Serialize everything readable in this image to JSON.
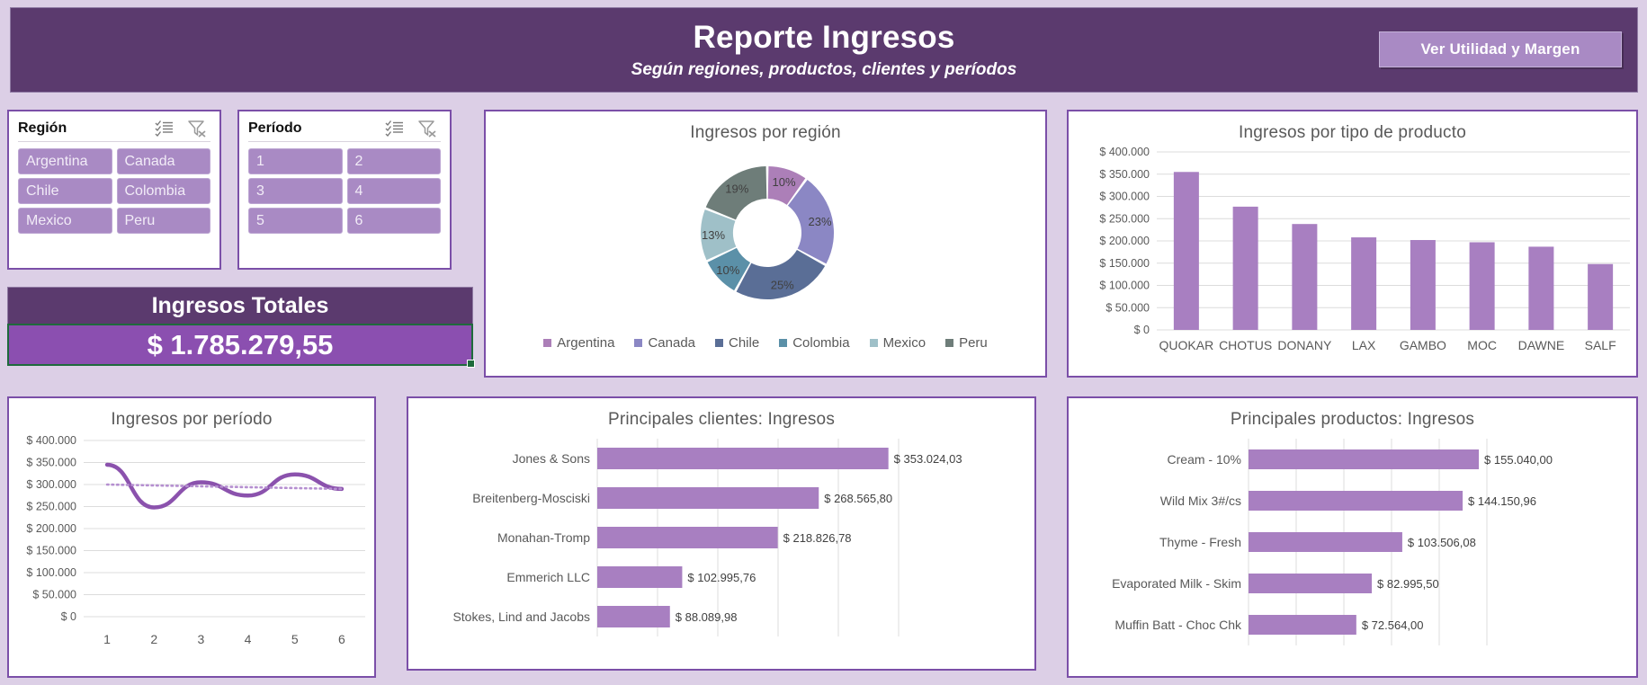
{
  "header": {
    "title": "Reporte Ingresos",
    "subtitle": "Según regiones, productos, clientes y períodos",
    "button_label": "Ver Utilidad y Margen",
    "bg_color": "#5b3a6e",
    "button_color": "#a98ac4"
  },
  "slicers": [
    {
      "name": "region",
      "title": "Región",
      "multiselect_icon": "multi-select-icon",
      "clear_filter_icon": "clear-filter-icon",
      "items": [
        "Argentina",
        "Canada",
        "Chile",
        "Colombia",
        "Mexico",
        "Peru"
      ]
    },
    {
      "name": "periodo",
      "title": "Período",
      "multiselect_icon": "multi-select-icon",
      "clear_filter_icon": "clear-filter-icon",
      "items": [
        "1",
        "2",
        "3",
        "4",
        "5",
        "6"
      ]
    }
  ],
  "kpi": {
    "title": "Ingresos Totales",
    "value": "$ 1.785.279,55",
    "selection_color": "#1e6b3c"
  },
  "chart_data": [
    {
      "id": "ingresos-por-region",
      "type": "pie",
      "title": "Ingresos por región",
      "legend_position": "bottom",
      "labels": [
        "Argentina",
        "Canada",
        "Chile",
        "Colombia",
        "Mexico",
        "Peru"
      ],
      "values": [
        10,
        23,
        25,
        10,
        13,
        19
      ],
      "data_labels": [
        "10%",
        "23%",
        "25%",
        "10%",
        "13%",
        "19%"
      ],
      "colors": [
        "#ac7fb8",
        "#8b87c4",
        "#5a6e96",
        "#5b90a8",
        "#9fc0c8",
        "#6e7d79"
      ]
    },
    {
      "id": "ingresos-por-tipo-de-producto",
      "type": "bar",
      "title": "Ingresos por tipo de producto",
      "categories": [
        "QUOKAR",
        "CHOTUS",
        "DONANY",
        "LAX",
        "GAMBO",
        "MOC",
        "DAWNE",
        "SALF"
      ],
      "values": [
        355000,
        277000,
        238000,
        208000,
        202000,
        197000,
        187000,
        148000
      ],
      "ylim": [
        0,
        400000
      ],
      "ytick_labels": [
        "$ 400.000",
        "$ 350.000",
        "$ 300.000",
        "$ 250.000",
        "$ 200.000",
        "$ 150.000",
        "$ 100.000",
        "$ 50.000",
        "$ 0"
      ],
      "grid": true,
      "xlabel": "",
      "ylabel": "",
      "color": "#a87fc1"
    },
    {
      "id": "ingresos-por-periodo",
      "type": "line",
      "title": "Ingresos por período",
      "categories": [
        "1",
        "2",
        "3",
        "4",
        "5",
        "6"
      ],
      "values": [
        345000,
        248000,
        305000,
        275000,
        323000,
        290000
      ],
      "trendline": [
        300000,
        298000,
        296000,
        294000,
        292000,
        290000
      ],
      "ylim": [
        0,
        400000
      ],
      "ytick_labels": [
        "$ 400.000",
        "$ 350.000",
        "$ 300.000",
        "$ 250.000",
        "$ 200.000",
        "$ 150.000",
        "$ 100.000",
        "$ 50.000",
        "$ 0"
      ],
      "grid": true,
      "color": "#8b52ad",
      "trendline_color": "#b58fd0"
    },
    {
      "id": "principales-clientes-ingresos",
      "type": "bar",
      "orientation": "horizontal",
      "title": "Principales clientes: Ingresos",
      "categories": [
        "Jones & Sons",
        "Breitenberg-Mosciski",
        "Monahan-Tromp",
        "Emmerich LLC",
        "Stokes, Lind and Jacobs"
      ],
      "values": [
        353024.03,
        268565.8,
        218826.78,
        102995.76,
        88089.98
      ],
      "data_labels": [
        "$ 353.024,03",
        "$ 268.565,80",
        "$ 218.826,78",
        "$ 102.995,76",
        "$ 88.089,98"
      ],
      "grid": true,
      "color": "#a87fc1"
    },
    {
      "id": "principales-productos-ingresos",
      "type": "bar",
      "orientation": "horizontal",
      "title": "Principales productos: Ingresos",
      "categories": [
        "Cream - 10%",
        "Wild Mix 3#/cs",
        "Thyme - Fresh",
        "Evaporated Milk - Skim",
        "Muffin Batt - Choc Chk"
      ],
      "values": [
        155040.0,
        144150.96,
        103506.08,
        82995.5,
        72564.0
      ],
      "data_labels": [
        "$ 155.040,00",
        "$ 144.150,96",
        "$ 103.506,08",
        "$ 82.995,50",
        "$ 72.564,00"
      ],
      "grid": true,
      "color": "#a87fc1"
    }
  ]
}
